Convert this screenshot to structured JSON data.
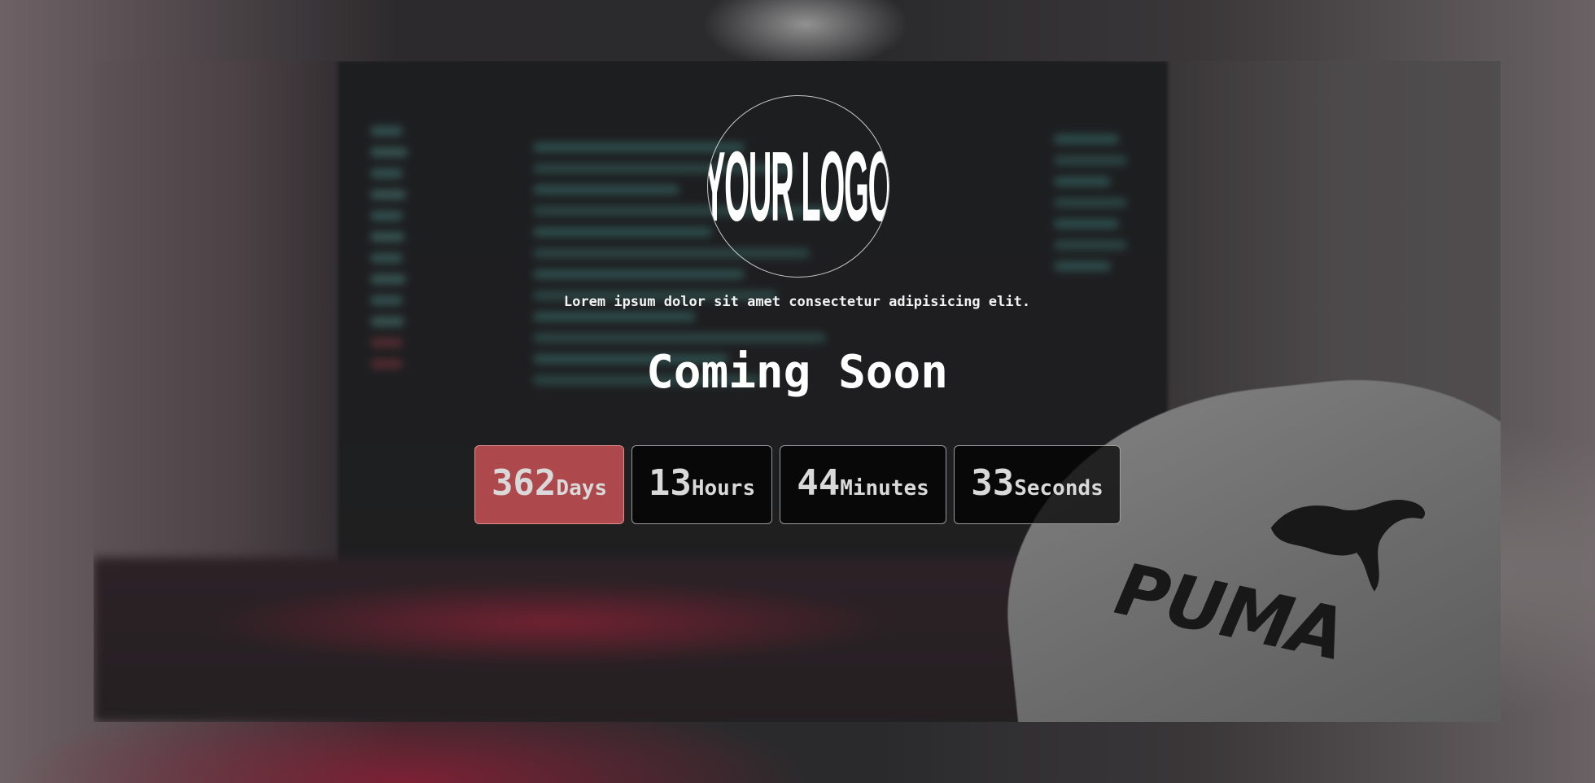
{
  "logo": {
    "text": "YOUR LOGO"
  },
  "tagline": "Lorem ipsum dolor sit amet consectetur adipisicing elit.",
  "headline": "Coming Soon",
  "countdown": [
    {
      "value": "362",
      "unit": "Days",
      "active": true
    },
    {
      "value": "13",
      "unit": "Hours",
      "active": false
    },
    {
      "value": "44",
      "unit": "Minutes",
      "active": false
    },
    {
      "value": "33",
      "unit": "Seconds",
      "active": false
    }
  ],
  "background": {
    "cap_brand": "PUMA"
  },
  "colors": {
    "accent": "#d65458",
    "tile_bg": "#000000",
    "text": "#ffffff"
  }
}
